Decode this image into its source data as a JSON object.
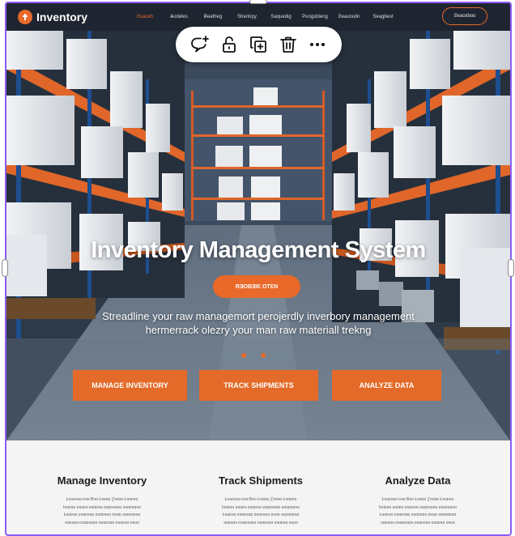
{
  "brand": {
    "name": "Inventory",
    "accent": "#e8692a",
    "nav_bg": "#1f2530"
  },
  "nav": {
    "links": [
      "Ƨuaceh",
      "Ѧodeles",
      "Ƀeatheg",
      "Shentıpy",
      "Saquedig",
      "Pungsbleng",
      "Ƨeaunulin",
      "Seagbest"
    ],
    "cta": "Ƨeaceboo"
  },
  "toolbar": {
    "items": [
      "comment-add-icon",
      "unlock-icon",
      "duplicate-icon",
      "delete-icon",
      "more-icon"
    ]
  },
  "hero": {
    "title": "Inventory Management System",
    "pill": "RƎOBƎIƐ OTƐN",
    "subtitle_line1": "Streadline your raw managemort perojerdly inverbory management",
    "subtitle_line2": "hermerrack olezry your man raw materiall trekng",
    "buttons": [
      "MANAGE INVENTORY",
      "TRACK SHIPMENTS",
      "ANALYZE DATA"
    ]
  },
  "features": [
    {
      "title": "Manage Inventory",
      "lines": [
        "Ƚoaesaɘ ɒɘɑ Ƀɘo Ƚɘɑɘɒ Ɀɘɑɘɒ Ƚɘɑɒɘɑ",
        "ƚɘɑɒɘɑ ɒɘɑɒɘ ɒɘɑɒɘɑ ɒɘɑɒɘɑɘɑ ɒɘɑɒɘɑɘɑ",
        "Ƚɘɑɒɘɑ ɒɘɑɒɘɑɒ ɒɘɑɒɘɑɘ ɒɘɑɒ ɘɑɒɘɑɒɘɑ",
        "ɘɑɒɘɑɘ ɒɘɑɒɘɑɒɘ ɒɘɑɒɘɑɘ ɒɘɑɒɘɑ ɒɘɑɘ"
      ]
    },
    {
      "title": "Track Shipments",
      "lines": [
        "Ƚoaesaɘ ɒɘɑ Ƀɘo Ƚɘɑɘɒ Ɀɘɑɘɒ Ƚɘɑɒɘɑ",
        "ƚɘɑɒɘɑ ɒɘɑɒɘ ɒɘɑɒɘɑ ɒɘɑɒɘɑɘɑ ɒɘɑɒɘɑɘɑ",
        "Ƚɘɑɒɘɑ ɒɘɑɒɘɑɒ ɒɘɑɒɘɑɘ ɒɘɑɒ ɘɑɒɘɑɒɘɑ",
        "ɘɑɒɘɑɘ ɒɘɑɒɘɑɒɘ ɒɘɑɒɘɑɘ ɒɘɑɒɘɑ ɒɘɑɘ"
      ]
    },
    {
      "title": "Analyze Data",
      "lines": [
        "Ƚoaesaɘ ɒɘɑ Ƀɘo Ƚɘɑɘɒ Ɀɘɑɘɒ Ƚɘɑɒɘɑ",
        "ƚɘɑɒɘɑ ɒɘɑɒɘ ɒɘɑɒɘɑ ɒɘɑɒɘɑɘɑ ɒɘɑɒɘɑɘɑ",
        "Ƚɘɑɒɘɑ ɒɘɑɒɘɑɒ ɒɘɑɒɘɑɘ ɒɘɑɒ ɘɑɒɘɑɒɘɑ",
        "ɘɑɒɘɑɘ ɒɘɑɒɘɑɒɘ ɒɘɑɒɘɑɘ ɒɘɑɒɘɑ ɒɘɑɘ"
      ]
    }
  ]
}
